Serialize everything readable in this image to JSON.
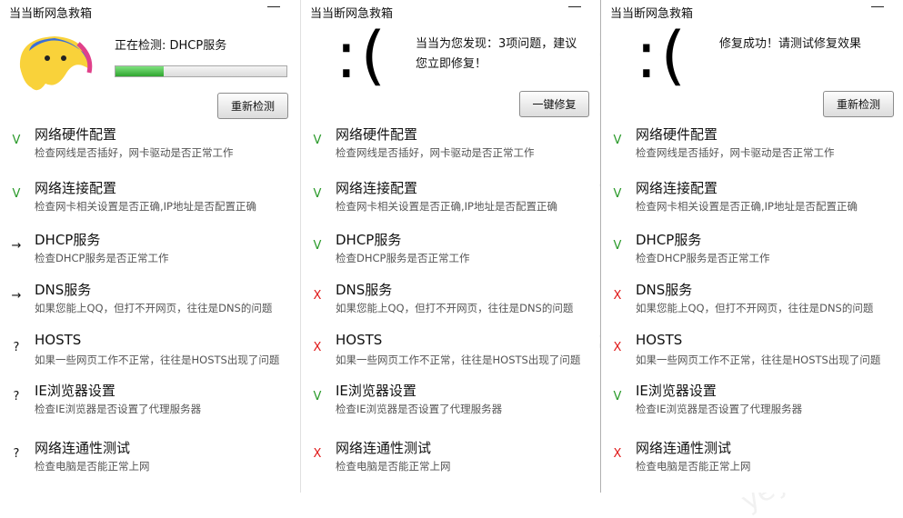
{
  "watermark": "yeyulingfeng.com",
  "panels": [
    {
      "title": "当当断网急救箱",
      "status": "正在检测: DHCP服务",
      "progress": 0.28,
      "button": "重新检测",
      "items": [
        {
          "name": "网络硬件配置",
          "desc": "检查网线是否插好，网卡驱动是否正常工作",
          "mark": "V",
          "state": "ok"
        },
        {
          "name": "网络连接配置",
          "desc": "检查网卡相关设置是否正确,IP地址是否配置正确",
          "mark": "V",
          "state": "ok"
        },
        {
          "name": "DHCP服务",
          "desc": "检查DHCP服务是否正常工作",
          "mark": "→",
          "state": "pending"
        },
        {
          "name": "DNS服务",
          "desc": "如果您能上QQ，但打不开网页，往往是DNS的问题",
          "mark": "→",
          "state": "pending"
        },
        {
          "name": "HOSTS",
          "desc": "如果一些网页工作不正常，往往是HOSTS出现了问题",
          "mark": "?",
          "state": "unknown"
        },
        {
          "name": "IE浏览器设置",
          "desc": "检查IE浏览器是否设置了代理服务器",
          "mark": "?",
          "state": "unknown"
        },
        {
          "name": "网络连通性测试",
          "desc": "检查电脑是否能正常上网",
          "mark": "?",
          "state": "unknown"
        }
      ]
    },
    {
      "title": "当当断网急救箱",
      "face": ":(",
      "status_line1": "当当为您发现：3项问题，建议",
      "status_line2": "您立即修复！",
      "button": "一键修复",
      "items": [
        {
          "name": "网络硬件配置",
          "desc": "检查网线是否插好，网卡驱动是否正常工作",
          "mark": "V",
          "state": "ok"
        },
        {
          "name": "网络连接配置",
          "desc": "检查网卡相关设置是否正确,IP地址是否配置正确",
          "mark": "V",
          "state": "ok"
        },
        {
          "name": "DHCP服务",
          "desc": "检查DHCP服务是否正常工作",
          "mark": "V",
          "state": "ok"
        },
        {
          "name": "DNS服务",
          "desc": "如果您能上QQ，但打不开网页，往往是DNS的问题",
          "mark": "X",
          "state": "fail"
        },
        {
          "name": "HOSTS",
          "desc": "如果一些网页工作不正常，往往是HOSTS出现了问题",
          "mark": "X",
          "state": "fail"
        },
        {
          "name": "IE浏览器设置",
          "desc": "检查IE浏览器是否设置了代理服务器",
          "mark": "V",
          "state": "ok"
        },
        {
          "name": "网络连通性测试",
          "desc": "检查电脑是否能正常上网",
          "mark": "X",
          "state": "fail"
        }
      ]
    },
    {
      "title": "当当断网急救箱",
      "face": ":(",
      "status": "修复成功！请测试修复效果",
      "button": "重新检测",
      "items": [
        {
          "name": "网络硬件配置",
          "desc": "检查网线是否插好，网卡驱动是否正常工作",
          "mark": "V",
          "state": "ok"
        },
        {
          "name": "网络连接配置",
          "desc": "检查网卡相关设置是否正确,IP地址是否配置正确",
          "mark": "V",
          "state": "ok"
        },
        {
          "name": "DHCP服务",
          "desc": "检查DHCP服务是否正常工作",
          "mark": "V",
          "state": "ok"
        },
        {
          "name": "DNS服务",
          "desc": "如果您能上QQ，但打不开网页，往往是DNS的问题",
          "mark": "X",
          "state": "fail"
        },
        {
          "name": "HOSTS",
          "desc": "如果一些网页工作不正常，往往是HOSTS出现了问题",
          "mark": "X",
          "state": "fail"
        },
        {
          "name": "IE浏览器设置",
          "desc": "检查IE浏览器是否设置了代理服务器",
          "mark": "V",
          "state": "ok"
        },
        {
          "name": "网络连通性测试",
          "desc": "检查电脑是否能正常上网",
          "mark": "X",
          "state": "fail"
        }
      ]
    }
  ]
}
